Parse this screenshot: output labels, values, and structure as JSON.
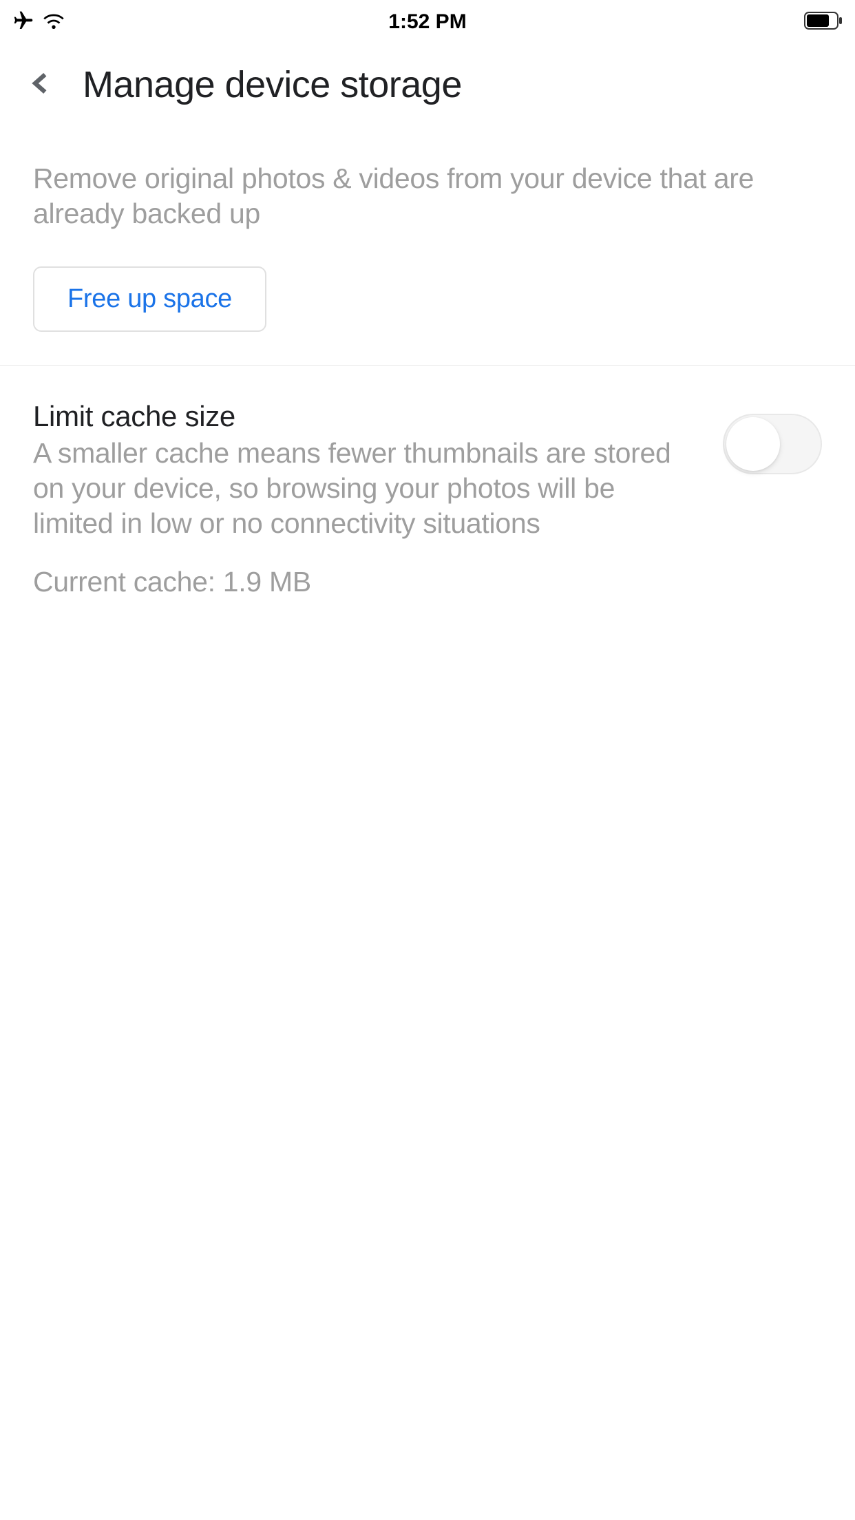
{
  "status_bar": {
    "time": "1:52 PM"
  },
  "header": {
    "title": "Manage device storage"
  },
  "section1": {
    "description": "Remove original photos & videos from your device that are already backed up",
    "button_label": "Free up space"
  },
  "section2": {
    "title": "Limit cache size",
    "description": "A smaller cache means fewer thumbnails are stored on your device, so browsing your photos will be limited in low or no connectivity situations",
    "current_cache": "Current cache: 1.9 MB",
    "toggle_state": "off"
  }
}
